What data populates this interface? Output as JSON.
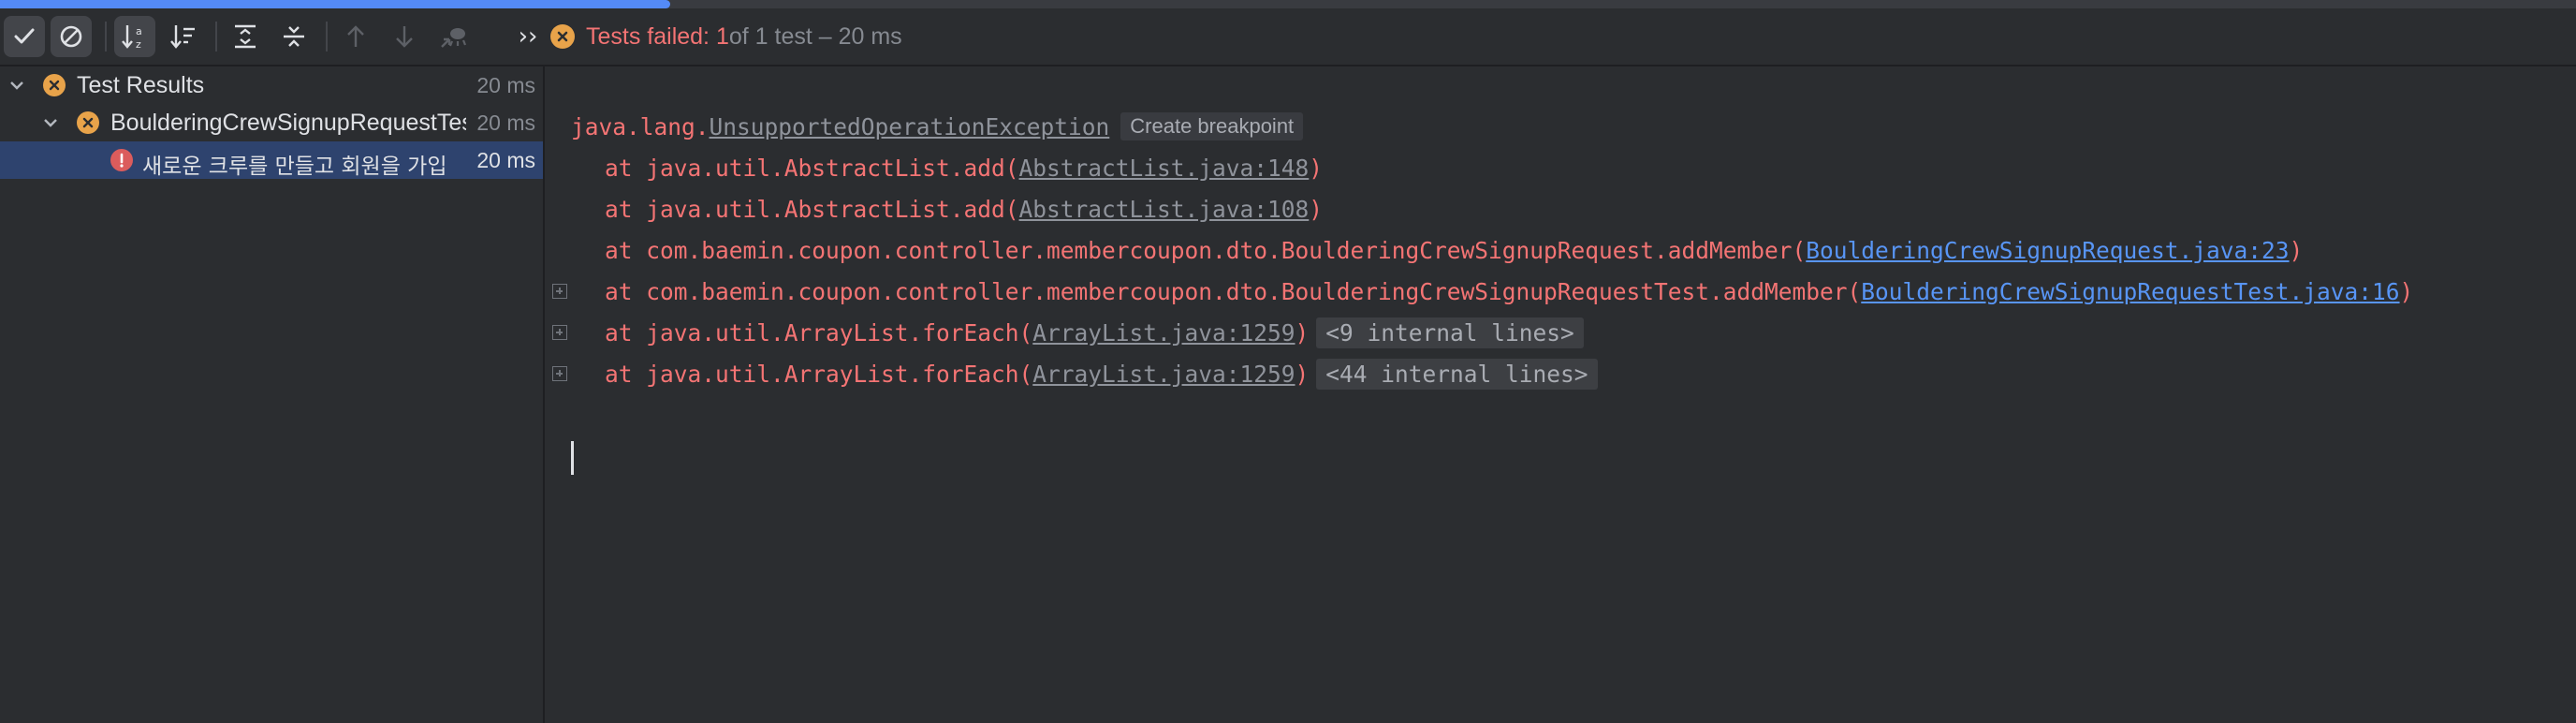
{
  "progress": {
    "fraction": 0.26,
    "color": "#548af7"
  },
  "toolbar": {
    "buttons": [
      {
        "name": "show-passed",
        "icon": "check-icon",
        "active": true
      },
      {
        "name": "show-ignored",
        "icon": "ban-icon",
        "active": true
      },
      {
        "name": "sort-alphabetically",
        "icon": "sort-alpha-icon",
        "active": true
      },
      {
        "name": "sort-by-duration",
        "icon": "sort-duration-icon",
        "active": false
      },
      {
        "name": "expand-all",
        "icon": "expand-all-icon",
        "active": false
      },
      {
        "name": "collapse-all",
        "icon": "collapse-all-icon",
        "active": false
      },
      {
        "name": "previous-failed",
        "icon": "arrow-up-icon",
        "active": false
      },
      {
        "name": "next-failed",
        "icon": "arrow-down-icon",
        "active": false
      },
      {
        "name": "import-tests",
        "icon": "import-icon",
        "active": false
      },
      {
        "name": "more",
        "icon": "double-chevron-right-icon",
        "active": false
      }
    ],
    "more_label": "››",
    "status": {
      "failed_text": "Tests failed: 1",
      "rest_text": " of 1 test – 20 ms"
    }
  },
  "tree": {
    "items": [
      {
        "label": "Test Results",
        "time": "20 ms",
        "status": "warning"
      },
      {
        "label": "BoulderingCrewSignupRequestTest",
        "time": "20 ms",
        "status": "warning"
      },
      {
        "label": "새로운 크루를 만들고 회원을 가입",
        "time": "20 ms",
        "status": "error"
      }
    ]
  },
  "console": {
    "exception_prefix": "java.lang.",
    "exception_name": "UnsupportedOperationException",
    "create_breakpoint": "Create breakpoint",
    "frames": [
      {
        "text": "at java.util.AbstractList.add(",
        "link": "AbstractList.java:148",
        "link_style": "gray",
        "tail": ")",
        "folded": "",
        "foldable": false
      },
      {
        "text": "at java.util.AbstractList.add(",
        "link": "AbstractList.java:108",
        "link_style": "gray",
        "tail": ")",
        "folded": "",
        "foldable": false
      },
      {
        "text": "at com.baemin.coupon.controller.membercoupon.dto.BoulderingCrewSignupRequest.addMember(",
        "link": "BoulderingCrewSignupRequest.java:23",
        "link_style": "blue",
        "tail": ")",
        "folded": "",
        "foldable": false
      },
      {
        "text": "at com.baemin.coupon.controller.membercoupon.dto.BoulderingCrewSignupRequestTest.addMember(",
        "link": "BoulderingCrewSignupRequestTest.java:16",
        "link_style": "blue",
        "tail": ")",
        "folded": "",
        "foldable": true
      },
      {
        "text": "at java.util.ArrayList.forEach(",
        "link": "ArrayList.java:1259",
        "link_style": "gray",
        "tail": ")",
        "folded": "<9 internal lines>",
        "foldable": true
      },
      {
        "text": "at java.util.ArrayList.forEach(",
        "link": "ArrayList.java:1259",
        "link_style": "gray",
        "tail": ")",
        "folded": "<44 internal lines>",
        "foldable": true
      }
    ]
  },
  "colors": {
    "error_text": "#f47474",
    "link_blue": "#5895f5",
    "warning_icon": "#e8a34a",
    "error_icon": "#db5c5c",
    "selection": "#2e436e"
  }
}
